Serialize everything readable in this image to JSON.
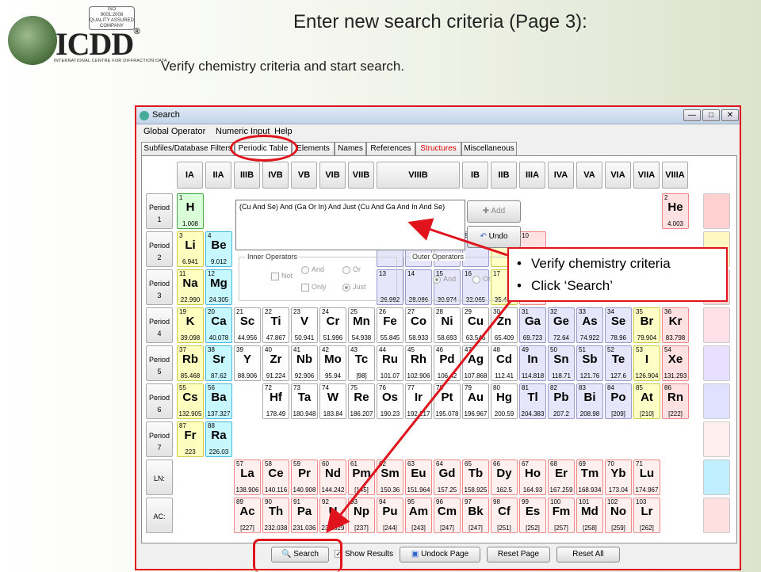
{
  "logo": {
    "brand": "ICDD",
    "registered": "®",
    "tagline": "INTERNATIONAL CENTRE FOR DIFFRACTION DATA",
    "seal_lines": [
      "ISO",
      "9001:2008",
      "QUALITY ASSURED COMPANY",
      "CERTIFICATE"
    ]
  },
  "slide": {
    "title": "Enter new search criteria (Page 3):",
    "subtitle": "Verify chemistry criteria and start search."
  },
  "window": {
    "title": "Search",
    "buttons": {
      "minimize": "—",
      "maximize": "□",
      "close": "✕"
    }
  },
  "menu": [
    "Global Operator",
    "Numeric Input",
    "Help"
  ],
  "tabs": [
    "Subfiles/Database Filters",
    "Periodic Table",
    "Elements",
    "Names",
    "References",
    "Structures",
    "Miscellaneous"
  ],
  "groups": [
    "IA",
    "IIA",
    "IIIB",
    "IVB",
    "VB",
    "VIB",
    "VIIB",
    "VIIIB",
    "IB",
    "IIB",
    "IIIA",
    "IVA",
    "VA",
    "VIA",
    "VIIA",
    "VIIIA"
  ],
  "periods": [
    "Period\n1",
    "Period\n2",
    "Period\n3",
    "Period\n4",
    "Period\n5",
    "Period\n6",
    "Period\n7",
    "LN:",
    "AC:"
  ],
  "criteria_text": "(Cu And Se) And (Ga Or In) And Just (Cu And Ga And In And Se)",
  "add_label": "Add",
  "undo_label": "Undo",
  "inner_ops": {
    "legend": "Inner Operators",
    "not": "Not",
    "and": "And",
    "or": "Or",
    "only": "Only",
    "just": "Just"
  },
  "outer_ops": {
    "legend": "Outer Operators",
    "and": "And",
    "or": "Or"
  },
  "bottom": {
    "search": "Search",
    "show_results": "Show Results",
    "undock": "Undock Page",
    "reset": "Reset Page",
    "reset_all": "Reset All"
  },
  "callout": [
    "Verify chemistry criteria",
    "Click ‘Search’"
  ],
  "elements": [
    [
      "1",
      "H",
      "1.008"
    ],
    [
      "2",
      "He",
      "4.003"
    ],
    [
      "3",
      "Li",
      "6.941"
    ],
    [
      "4",
      "Be",
      "9.012"
    ],
    [
      "5",
      "",
      ""
    ],
    [
      "6",
      "",
      ""
    ],
    [
      "7",
      "",
      ""
    ],
    [
      "8",
      "",
      ""
    ],
    [
      "9",
      "",
      ""
    ],
    [
      "10",
      "",
      ""
    ],
    [
      "11",
      "Na",
      "22.990"
    ],
    [
      "12",
      "Mg",
      "24.305"
    ],
    [
      "13",
      "",
      "26.982"
    ],
    [
      "14",
      "",
      "28.086"
    ],
    [
      "15",
      "",
      "30.974"
    ],
    [
      "16",
      "",
      "32.065"
    ],
    [
      "17",
      "",
      "35.453"
    ],
    [
      "18",
      "",
      "39.948"
    ],
    [
      "19",
      "K",
      "39.098"
    ],
    [
      "20",
      "Ca",
      "40.078"
    ],
    [
      "21",
      "Sc",
      "44.956"
    ],
    [
      "22",
      "Ti",
      "47.867"
    ],
    [
      "23",
      "V",
      "50.941"
    ],
    [
      "24",
      "Cr",
      "51.996"
    ],
    [
      "25",
      "Mn",
      "54.938"
    ],
    [
      "26",
      "Fe",
      "55.845"
    ],
    [
      "27",
      "Co",
      "58.933"
    ],
    [
      "28",
      "Ni",
      "58.693"
    ],
    [
      "29",
      "Cu",
      "63.546"
    ],
    [
      "30",
      "Zn",
      "65.409"
    ],
    [
      "31",
      "Ga",
      "69.723"
    ],
    [
      "32",
      "Ge",
      "72.64"
    ],
    [
      "33",
      "As",
      "74.922"
    ],
    [
      "34",
      "Se",
      "78.96"
    ],
    [
      "35",
      "Br",
      "79.904"
    ],
    [
      "36",
      "Kr",
      "83.798"
    ],
    [
      "37",
      "Rb",
      "85.468"
    ],
    [
      "38",
      "Sr",
      "87.62"
    ],
    [
      "39",
      "Y",
      "88.906"
    ],
    [
      "40",
      "Zr",
      "91.224"
    ],
    [
      "41",
      "Nb",
      "92.906"
    ],
    [
      "42",
      "Mo",
      "95.94"
    ],
    [
      "43",
      "Tc",
      "[98]"
    ],
    [
      "44",
      "Ru",
      "101.07"
    ],
    [
      "45",
      "Rh",
      "102.906"
    ],
    [
      "46",
      "Pd",
      "106.42"
    ],
    [
      "47",
      "Ag",
      "107.868"
    ],
    [
      "48",
      "Cd",
      "112.41"
    ],
    [
      "49",
      "In",
      "114.818"
    ],
    [
      "50",
      "Sn",
      "118.71"
    ],
    [
      "51",
      "Sb",
      "121.76"
    ],
    [
      "52",
      "Te",
      "127.6"
    ],
    [
      "53",
      "I",
      "126.904"
    ],
    [
      "54",
      "Xe",
      "131.293"
    ],
    [
      "55",
      "Cs",
      "132.905"
    ],
    [
      "56",
      "Ba",
      "137.327"
    ],
    [
      "72",
      "Hf",
      "178.49"
    ],
    [
      "73",
      "Ta",
      "180.948"
    ],
    [
      "74",
      "W",
      "183.84"
    ],
    [
      "75",
      "Re",
      "186.207"
    ],
    [
      "76",
      "Os",
      "190.23"
    ],
    [
      "77",
      "Ir",
      "192.217"
    ],
    [
      "78",
      "Pt",
      "195.078"
    ],
    [
      "79",
      "Au",
      "196.967"
    ],
    [
      "80",
      "Hg",
      "200.59"
    ],
    [
      "81",
      "Tl",
      "204.383"
    ],
    [
      "82",
      "Pb",
      "207.2"
    ],
    [
      "83",
      "Bi",
      "208.98"
    ],
    [
      "84",
      "Po",
      "[209]"
    ],
    [
      "85",
      "At",
      "[210]"
    ],
    [
      "86",
      "Rn",
      "[222]"
    ],
    [
      "87",
      "Fr",
      "223"
    ],
    [
      "88",
      "Ra",
      "226.03"
    ],
    [
      "57",
      "La",
      "138.906"
    ],
    [
      "58",
      "Ce",
      "140.116"
    ],
    [
      "59",
      "Pr",
      "140.908"
    ],
    [
      "60",
      "Nd",
      "144.242"
    ],
    [
      "61",
      "Pm",
      "[145]"
    ],
    [
      "62",
      "Sm",
      "150.36"
    ],
    [
      "63",
      "Eu",
      "151.964"
    ],
    [
      "64",
      "Gd",
      "157.25"
    ],
    [
      "65",
      "Tb",
      "158.925"
    ],
    [
      "66",
      "Dy",
      "162.5"
    ],
    [
      "67",
      "Ho",
      "164.93"
    ],
    [
      "68",
      "Er",
      "167.259"
    ],
    [
      "69",
      "Tm",
      "168.934"
    ],
    [
      "70",
      "Yb",
      "173.04"
    ],
    [
      "71",
      "Lu",
      "174.967"
    ],
    [
      "89",
      "Ac",
      "[227]"
    ],
    [
      "90",
      "Th",
      "232.038"
    ],
    [
      "91",
      "Pa",
      "231.036"
    ],
    [
      "92",
      "U",
      "238.029"
    ],
    [
      "93",
      "Np",
      "[237]"
    ],
    [
      "94",
      "Pu",
      "[244]"
    ],
    [
      "95",
      "Am",
      "[243]"
    ],
    [
      "96",
      "Cm",
      "[247]"
    ],
    [
      "97",
      "Bk",
      "[247]"
    ],
    [
      "98",
      "Cf",
      "[251]"
    ],
    [
      "99",
      "Es",
      "[252]"
    ],
    [
      "100",
      "Fm",
      "[257]"
    ],
    [
      "101",
      "Md",
      "[258]"
    ],
    [
      "102",
      "No",
      "[259]"
    ],
    [
      "103",
      "Lr",
      "[262]"
    ]
  ],
  "colors": {
    "alkali": "#ffffc0",
    "alkaline": "#c8f8ff",
    "transition": "#ffffff",
    "post": "#e6e6fa",
    "halogen": "#ffffc8",
    "noble": "#ffe1e1",
    "lanthanide": "#fff0f0",
    "hydrogen": "#d8ffd8",
    "accent": "#e0141c"
  }
}
